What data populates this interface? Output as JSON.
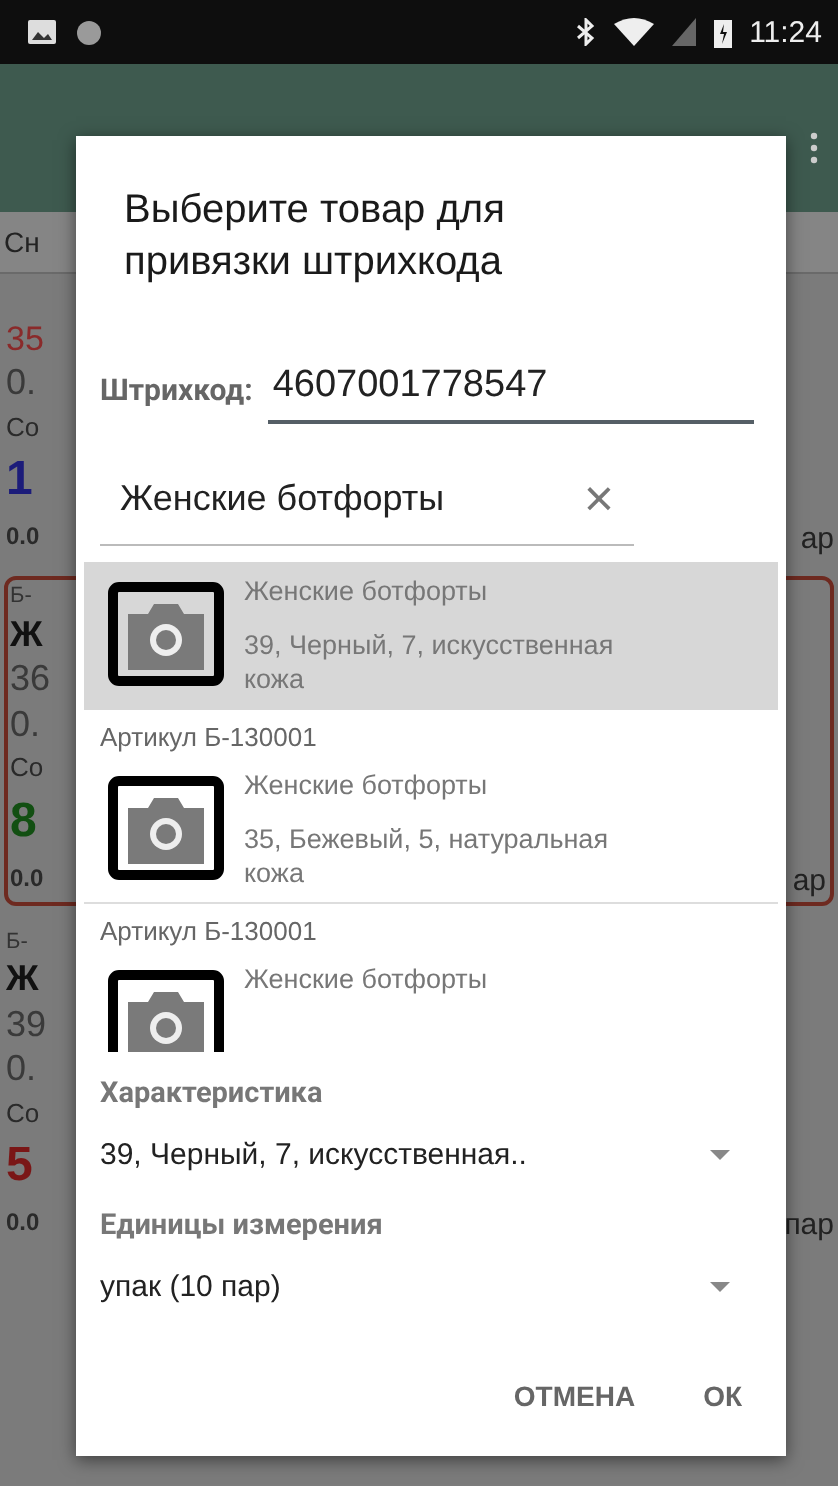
{
  "status_bar": {
    "time": "11:24"
  },
  "background": {
    "subheader": "Сн",
    "blocks": [
      {
        "card": false,
        "lines": [
          {
            "text": "35",
            "kind": "num",
            "color": "#8a2a2a"
          },
          {
            "text": "0.",
            "kind": "mid"
          },
          {
            "text": "Со",
            "kind": "small"
          },
          {
            "text": "1",
            "kind": "big",
            "color": "#1c1c7a"
          },
          {
            "text": "0.0",
            "kind": "bold"
          }
        ],
        "tail": "ap"
      },
      {
        "card": true,
        "lines": [
          {
            "text": "Б-",
            "kind": "tiny"
          },
          {
            "text": "Ж",
            "kind": "name"
          },
          {
            "text": "36",
            "kind": "mid"
          },
          {
            "text": "0.",
            "kind": "mid"
          },
          {
            "text": "Со",
            "kind": "small"
          },
          {
            "text": "8",
            "kind": "big",
            "color": "#124f12"
          },
          {
            "text": "0.0",
            "kind": "bold"
          }
        ],
        "tail": "ap"
      },
      {
        "card": false,
        "lines": [
          {
            "text": "Б-",
            "kind": "tiny"
          },
          {
            "text": "Ж",
            "kind": "name"
          },
          {
            "text": "39",
            "kind": "mid"
          },
          {
            "text": "0.",
            "kind": "mid"
          },
          {
            "text": "Со",
            "kind": "small"
          },
          {
            "text": "5",
            "kind": "big",
            "color": "#7a1616"
          },
          {
            "text": "0.0",
            "kind": "bold"
          }
        ],
        "tail": "пар"
      }
    ]
  },
  "dialog": {
    "title": "Выберите товар для привязки штрихкода",
    "barcode": {
      "label": "Штрихкод:",
      "value": "4607001778547"
    },
    "search": {
      "value": "Женские ботфорты",
      "clear": "×"
    },
    "items": [
      {
        "name": "Женские ботфорты",
        "description": "39, Черный, 7, искусственная кожа",
        "selected": true
      },
      {
        "article": "Артикул  Б-130001",
        "name": "Женские ботфорты",
        "description": "35, Бежевый, 5, натуральная кожа",
        "selected": false
      },
      {
        "article": "Артикул  Б-130001",
        "name": "Женские ботфорты",
        "selected": false
      }
    ],
    "fields": [
      {
        "label": "Характеристика",
        "value": "39, Черный, 7, искусственная.."
      },
      {
        "label": "Единицы измерения",
        "value": "упак (10 пар)"
      }
    ],
    "buttons": [
      "ОТМЕНА",
      "ОК"
    ]
  }
}
